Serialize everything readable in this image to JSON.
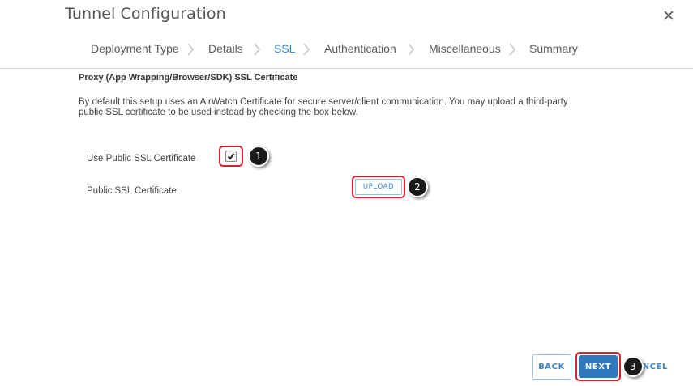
{
  "dialog": {
    "title": "Tunnel Configuration",
    "close_symbol": "✕"
  },
  "steps": [
    {
      "label": "Deployment Type",
      "active": false
    },
    {
      "label": "Details",
      "active": false
    },
    {
      "label": "SSL",
      "active": true
    },
    {
      "label": "Authentication",
      "active": false
    },
    {
      "label": "Miscellaneous",
      "active": false
    },
    {
      "label": "Summary",
      "active": false
    }
  ],
  "section": {
    "heading": "Proxy (App Wrapping/Browser/SDK) SSL Certificate",
    "description": "By default this setup uses an AirWatch Certificate for secure server/client communication. You may upload a third-party public SSL certificate to be used instead by checking the box below."
  },
  "form": {
    "use_public_ssl_label": "Use Public SSL Certificate",
    "use_public_ssl_checked": true,
    "public_ssl_label": "Public SSL Certificate",
    "upload_label": "UPLOAD"
  },
  "annotations": [
    "1",
    "2",
    "3"
  ],
  "footer": {
    "back_label": "BACK",
    "next_label": "NEXT",
    "cancel_label": "NCEL"
  },
  "colors": {
    "accent": "#3a87c8",
    "primary_button": "#2f78bd",
    "highlight": "#d8212f"
  }
}
